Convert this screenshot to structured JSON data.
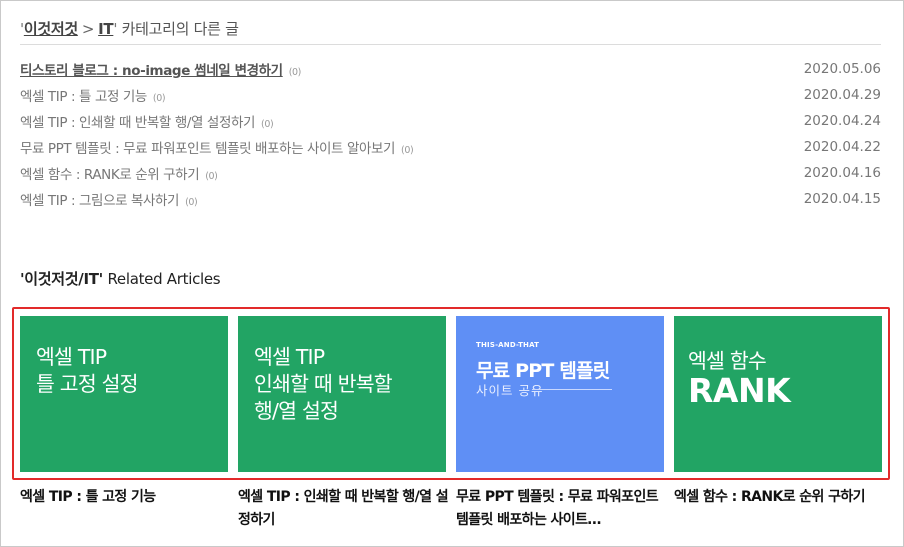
{
  "category_header": {
    "open_quote": "'",
    "category_path": "이것저것",
    "separator": ">",
    "category_leaf": "IT",
    "close_quote": "'",
    "suffix": " 카테고리의 다른 글"
  },
  "posts": [
    {
      "title": "티스토리 블로그 : no-image 썸네일 변경하기",
      "count": "(0)",
      "date": "2020.05.06",
      "current": true
    },
    {
      "title": "엑셀 TIP : 틀 고정 기능",
      "count": "(0)",
      "date": "2020.04.29",
      "current": false
    },
    {
      "title": "엑셀 TIP : 인쇄할 때 반복할 행/열 설정하기",
      "count": "(0)",
      "date": "2020.04.24",
      "current": false
    },
    {
      "title": "무료 PPT 템플릿 : 무료 파워포인트 템플릿 배포하는 사이트 알아보기",
      "count": "(0)",
      "date": "2020.04.22",
      "current": false
    },
    {
      "title": "엑셀 함수 : RANK로 순위 구하기",
      "count": "(0)",
      "date": "2020.04.16",
      "current": false
    },
    {
      "title": "엑셀 TIP : 그림으로 복사하기",
      "count": "(0)",
      "date": "2020.04.15",
      "current": false
    }
  ],
  "related": {
    "heading_bold": "'이것저것/IT'",
    "heading_text": " Related Articles",
    "highlight_color": "#e22a2a",
    "items": [
      {
        "thumb_style": "green",
        "thumb_color": "#22a464",
        "thumb_lines": [
          "엑셀 TIP",
          "틀 고정 설정"
        ],
        "caption": "엑셀 TIP : 틀 고정 기능"
      },
      {
        "thumb_style": "green",
        "thumb_color": "#22a464",
        "thumb_lines": [
          "엑셀 TIP",
          "인쇄할 때 반복할",
          "행/열 설정"
        ],
        "caption": "엑셀 TIP : 인쇄할 때 반복할 행/열 설정하기"
      },
      {
        "thumb_style": "blue",
        "thumb_color": "#5f8ff5",
        "kicker": "THIS-AND-THAT",
        "thumb_title": "무료 PPT 템플릿",
        "thumb_sub": "사이트 공유",
        "caption": "무료 PPT 템플릿 : 무료 파워포인트 템플릿 배포하는 사이트…"
      },
      {
        "thumb_style": "green",
        "thumb_color": "#22a464",
        "thumb_line1": "엑셀 함수",
        "thumb_line2": "RANK",
        "caption": "엑셀 함수 : RANK로 순위 구하기"
      }
    ]
  }
}
